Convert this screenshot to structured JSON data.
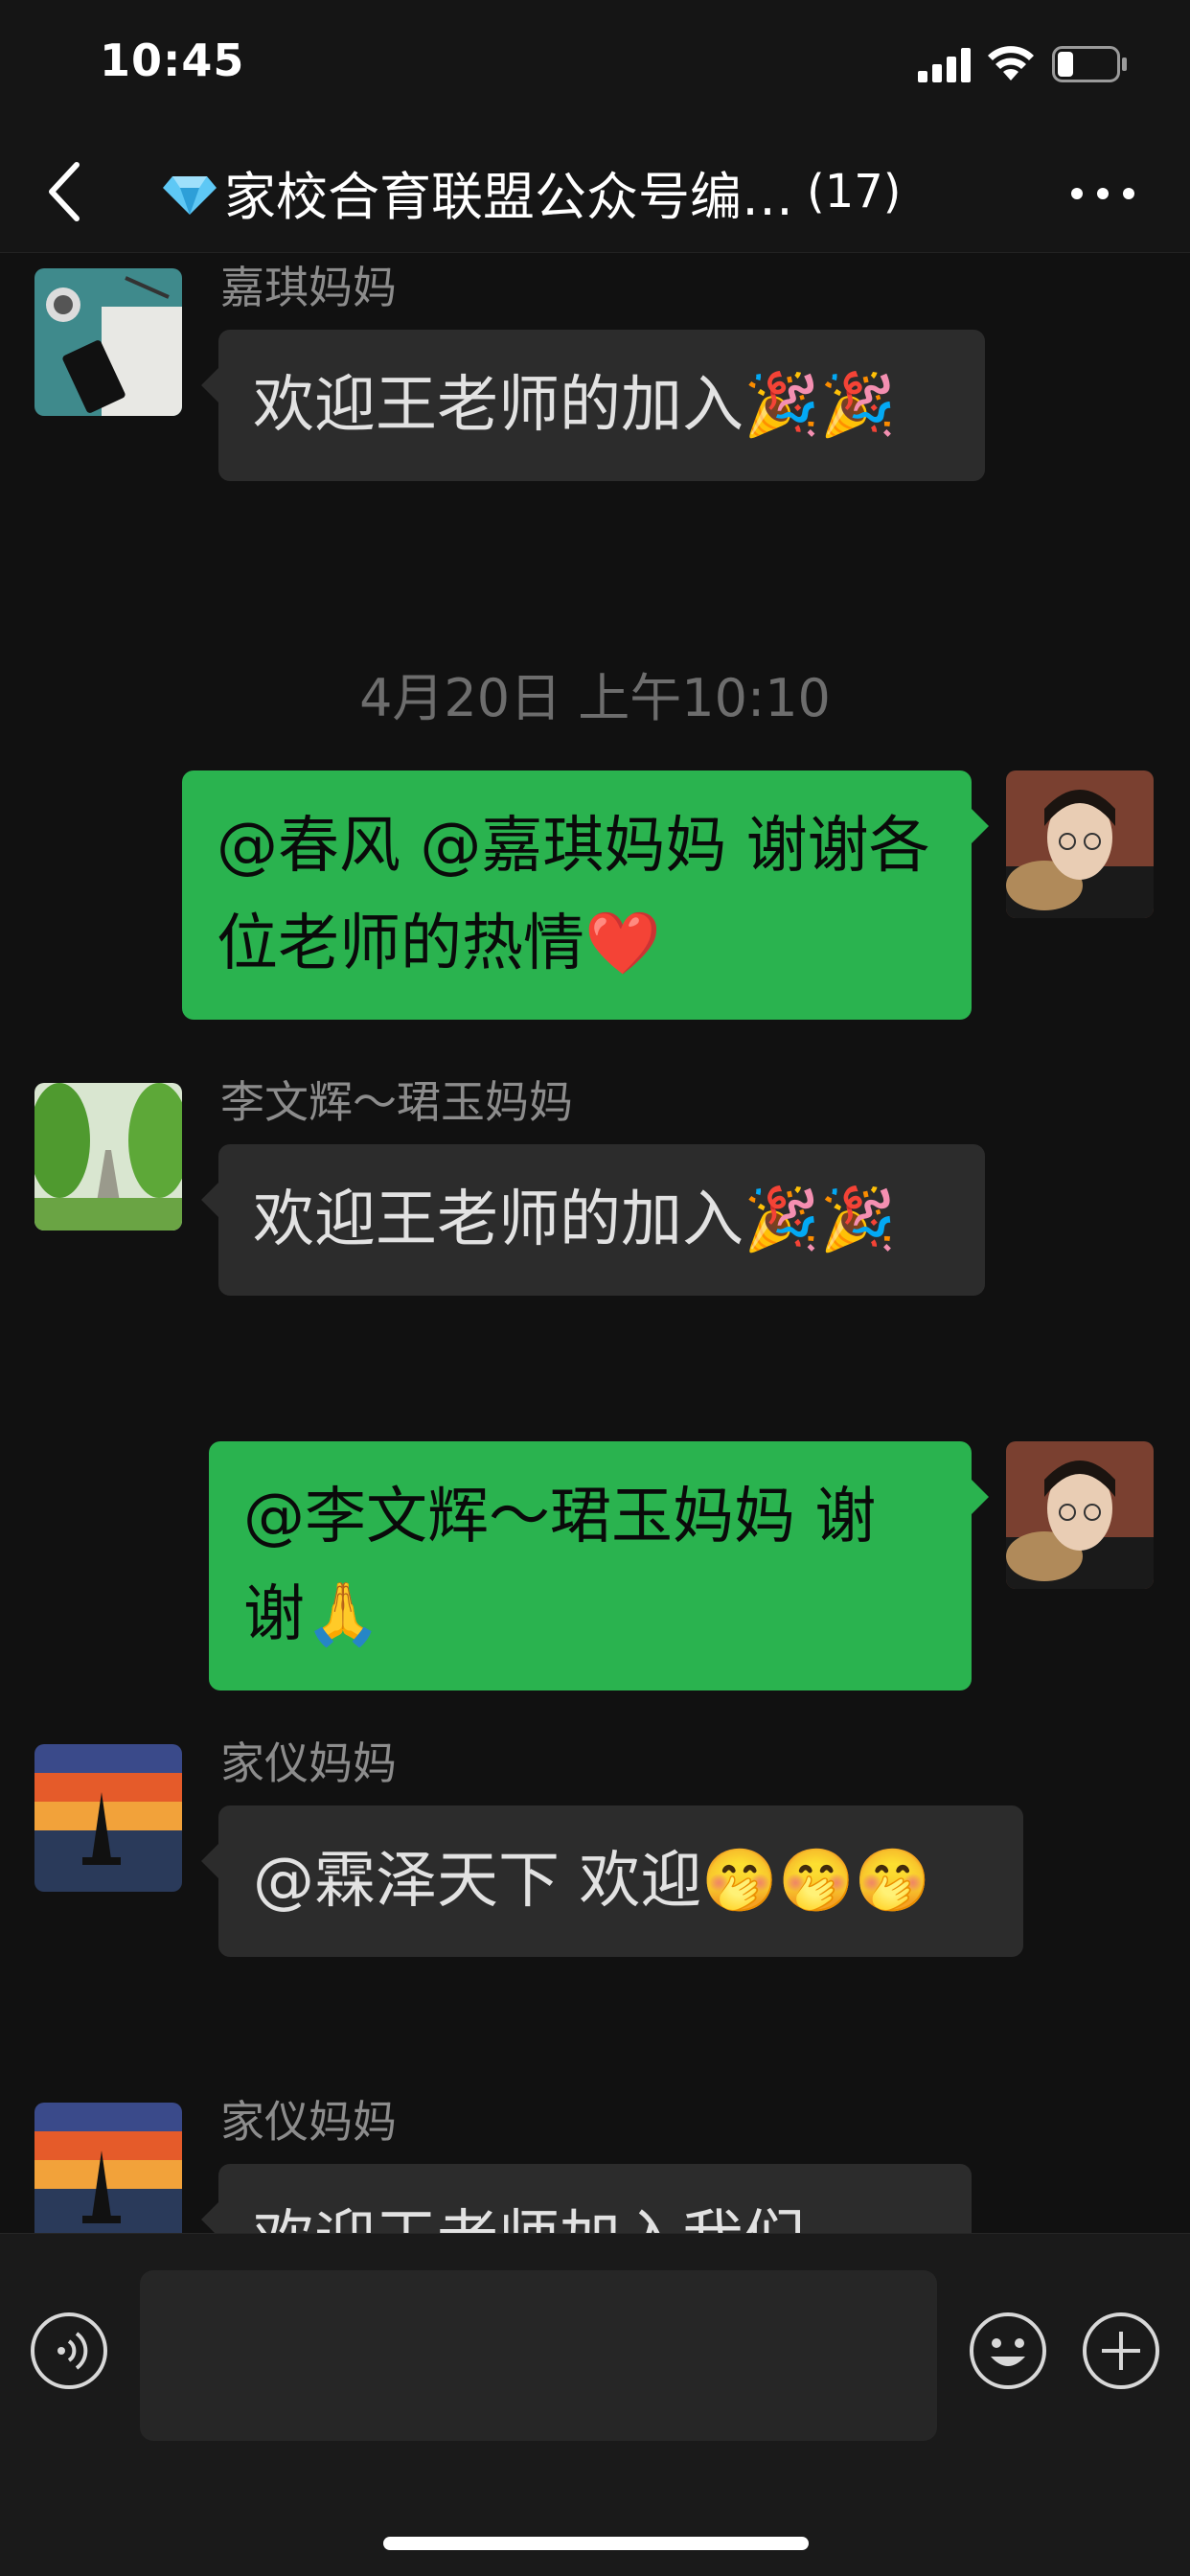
{
  "status_bar": {
    "time": "10:45"
  },
  "nav": {
    "title": "家校合育联盟公众号编…",
    "member_count": "(17)",
    "icons": {
      "back": "chevron-left-icon",
      "gem": "gem-icon",
      "more": "more-dots-icon"
    }
  },
  "messages": [
    {
      "type": "incoming",
      "sender": "嘉琪妈妈",
      "text": "欢迎王老师的加入🎉🎉",
      "avatar": "desk-photo"
    },
    {
      "type": "timestamp",
      "text": "4月20日 上午10:10"
    },
    {
      "type": "outgoing",
      "text": "@春风 @嘉琪妈妈 谢谢各位老师的热情❤️",
      "avatar": "self-portrait"
    },
    {
      "type": "incoming",
      "sender": "李文辉～珺玉妈妈",
      "text": "欢迎王老师的加入🎉🎉",
      "avatar": "tree-road-photo"
    },
    {
      "type": "outgoing",
      "text": "@李文辉～珺玉妈妈 谢谢🙏",
      "avatar": "self-portrait"
    },
    {
      "type": "incoming",
      "sender": "家仪妈妈",
      "text": "@霖泽天下 欢迎🤭🤭🤭",
      "avatar": "sunset-sailboat-painting"
    },
    {
      "type": "incoming",
      "sender": "家仪妈妈",
      "text": "欢迎王老师加入我们",
      "avatar": "sunset-sailboat-painting"
    }
  ],
  "input_bar": {
    "placeholder": "",
    "icons": {
      "voice": "voice-icon",
      "emoji": "emoji-icon",
      "plus": "plus-icon"
    }
  },
  "colors": {
    "background": "#111111",
    "incoming_bubble": "#2c2c2c",
    "outgoing_bubble": "#2ab34f",
    "sender_text": "#8c8c8c"
  }
}
